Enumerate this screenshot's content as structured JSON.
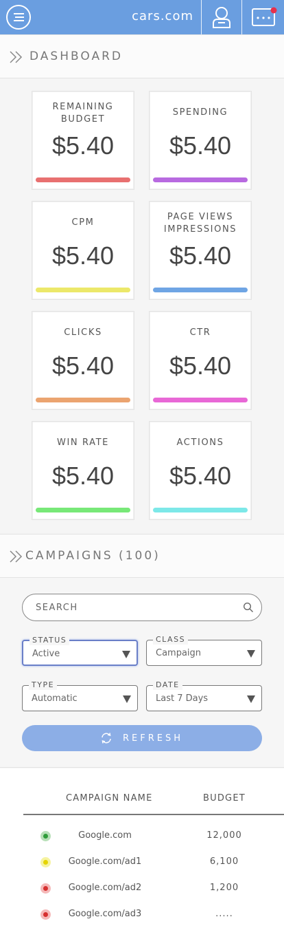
{
  "header": {
    "brand": "cars.com"
  },
  "dashboard": {
    "title": "DASHBOARD",
    "cards": [
      {
        "label": "REMAINING BUDGET",
        "value": "$5.40",
        "color": "#e87070"
      },
      {
        "label": "SPENDING",
        "value": "$5.40",
        "color": "#b86ae0"
      },
      {
        "label": "CPM",
        "value": "$5.40",
        "color": "#ece86a"
      },
      {
        "label": "PAGE VIEWS IMPRESSIONS",
        "value": "$5.40",
        "color": "#6fa5e4"
      },
      {
        "label": "CLICKS",
        "value": "$5.40",
        "color": "#eba470"
      },
      {
        "label": "CTR",
        "value": "$5.40",
        "color": "#e868d6"
      },
      {
        "label": "WIN RATE",
        "value": "$5.40",
        "color": "#78e878"
      },
      {
        "label": "ACTIONS",
        "value": "$5.40",
        "color": "#7de8e8"
      }
    ]
  },
  "campaigns": {
    "title": "CAMPAIGNS (100)",
    "search_placeholder": "SEARCH",
    "filters": [
      {
        "legend": "STATUS",
        "value": "Active",
        "active": true
      },
      {
        "legend": "CLASS",
        "value": "Campaign",
        "active": false
      },
      {
        "legend": "TYPE",
        "value": "Automatic",
        "active": false
      },
      {
        "legend": "DATE",
        "value": "Last 7 Days",
        "active": false
      }
    ],
    "refresh_label": "REFRESH",
    "table": {
      "columns": [
        "CAMPAIGN NAME",
        "BUDGET"
      ],
      "rows": [
        {
          "status": "green",
          "name": "Google.com",
          "budget": "12,000"
        },
        {
          "status": "yellow",
          "name": "Google.com/ad1",
          "budget": "6,100"
        },
        {
          "status": "red",
          "name": "Google.com/ad2",
          "budget": "1,200"
        },
        {
          "status": "red",
          "name": "Google.com/ad3",
          "budget": "....."
        }
      ]
    }
  }
}
